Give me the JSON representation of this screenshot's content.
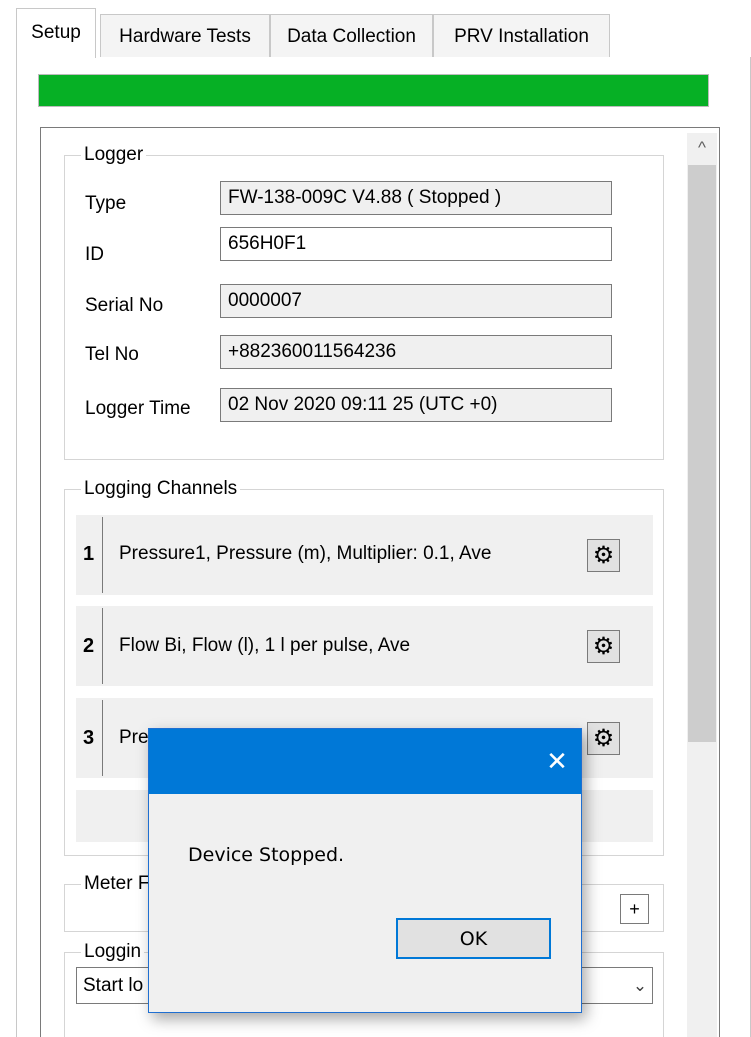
{
  "tabs": [
    {
      "label": "Setup",
      "active": true
    },
    {
      "label": "Hardware Tests",
      "active": false
    },
    {
      "label": "Data Collection",
      "active": false
    },
    {
      "label": "PRV Installation",
      "active": false
    }
  ],
  "progress": {
    "value_percent": 100,
    "color": "#06b025"
  },
  "logger": {
    "legend": "Logger",
    "type_label": "Type",
    "type_value": "FW-138-009C V4.88    ( Stopped )",
    "id_label": "ID",
    "id_value": "656H0F1",
    "serial_label": "Serial No",
    "serial_value": "0000007",
    "tel_label": "Tel No",
    "tel_value": "+882360011564236",
    "time_label": "Logger Time",
    "time_value": "02 Nov 2020    09:11 25  (UTC +0)"
  },
  "channels": {
    "legend": "Logging Channels",
    "items": [
      {
        "number": "1",
        "description": "Pressure1, Pressure (m), Multiplier: 0.1, Ave",
        "icon": "gear-icon"
      },
      {
        "number": "2",
        "description": "Flow Bi, Flow (l), 1 l per pulse, Ave",
        "icon": "gear-icon"
      },
      {
        "number": "3",
        "description": "Pre",
        "icon": "gear-icon"
      }
    ]
  },
  "meter": {
    "legend": "Meter F",
    "add_label": "+"
  },
  "logging": {
    "legend": "Loggin",
    "combo_value": "Start lo"
  },
  "dialog": {
    "message": "Device Stopped.",
    "ok_label": "OK",
    "close_glyph": "✕",
    "accent": "#0078d7"
  },
  "scrollbar": {
    "up_glyph": "^"
  }
}
